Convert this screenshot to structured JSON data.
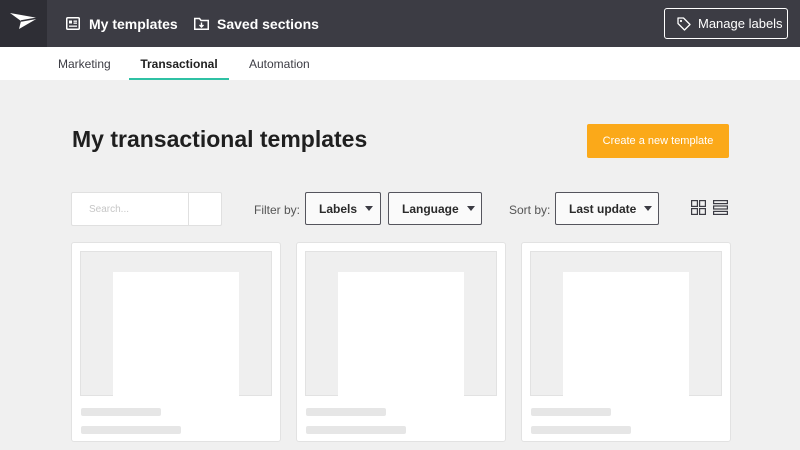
{
  "header": {
    "nav": [
      {
        "label": "My templates",
        "icon": "template-list-icon"
      },
      {
        "label": "Saved sections",
        "icon": "folder-download-icon"
      }
    ],
    "manage_labels": {
      "label": "Manage labels",
      "icon": "tag-icon"
    }
  },
  "tabs": [
    {
      "label": "Marketing",
      "active": false
    },
    {
      "label": "Transactional",
      "active": true
    },
    {
      "label": "Automation",
      "active": false
    }
  ],
  "page": {
    "title": "My transactional templates",
    "create_button": "Create a new template"
  },
  "controls": {
    "search": {
      "placeholder": "Search...",
      "value": ""
    },
    "filter_label": "Filter by:",
    "filters": [
      "Labels",
      "Language"
    ],
    "sort_label": "Sort by:",
    "sort_value": "Last update",
    "views": [
      "grid-view-icon",
      "list-view-icon"
    ]
  },
  "colors": {
    "topbar": "#3c3c44",
    "accent_tab": "#2fc1a4",
    "primary_button": "#fba919"
  },
  "cards": [
    {
      "state": "loading"
    },
    {
      "state": "loading"
    },
    {
      "state": "loading"
    }
  ]
}
